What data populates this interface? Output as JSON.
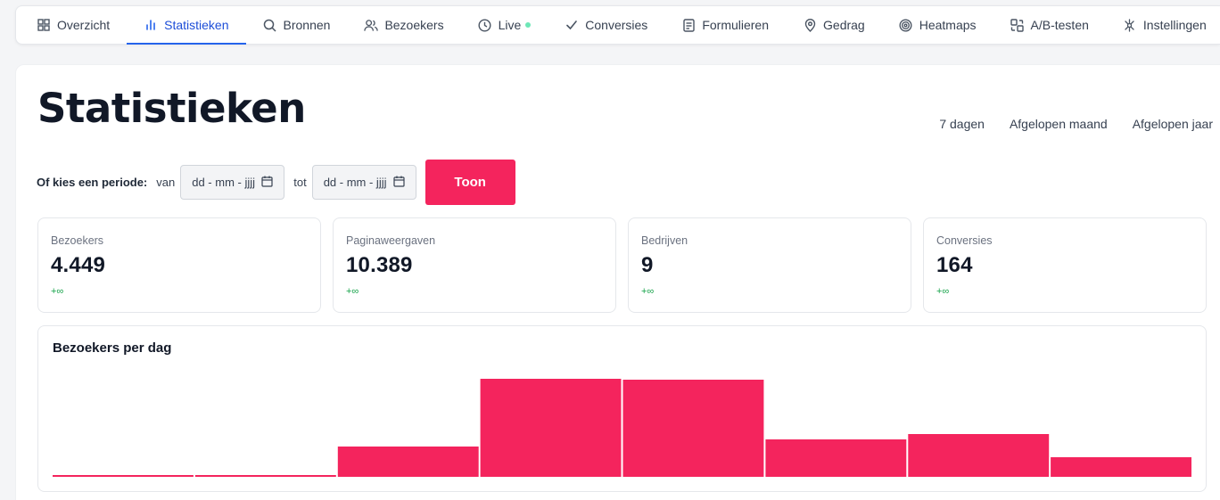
{
  "nav": {
    "tabs": [
      {
        "label": "Overzicht",
        "icon": "grid-icon"
      },
      {
        "label": "Statistieken",
        "icon": "bar-chart-icon",
        "active": true
      },
      {
        "label": "Bronnen",
        "icon": "search-icon"
      },
      {
        "label": "Bezoekers",
        "icon": "users-icon"
      },
      {
        "label": "Live",
        "icon": "clock-icon"
      },
      {
        "label": "Conversies",
        "icon": "check-icon"
      },
      {
        "label": "Formulieren",
        "icon": "form-icon"
      },
      {
        "label": "Gedrag",
        "icon": "map-pin-icon"
      },
      {
        "label": "Heatmaps",
        "icon": "target-icon"
      },
      {
        "label": "A/B-testen",
        "icon": "ab-test-icon"
      },
      {
        "label": "Instellingen",
        "icon": "settings-icon"
      }
    ]
  },
  "page": {
    "title": "Statistieken",
    "quick_ranges": [
      "7 dagen",
      "Afgelopen maand",
      "Afgelopen jaar"
    ]
  },
  "period": {
    "label": "Of kies een periode:",
    "from_word": "van",
    "to_word": "tot",
    "from_placeholder": "dd - mm - jjjj",
    "to_placeholder": "dd - mm - jjjj",
    "submit_label": "Toon"
  },
  "stats": [
    {
      "label": "Bezoekers",
      "value": "4.449",
      "change": "+∞"
    },
    {
      "label": "Paginaweergaven",
      "value": "10.389",
      "change": "+∞"
    },
    {
      "label": "Bedrijven",
      "value": "9",
      "change": "+∞"
    },
    {
      "label": "Conversies",
      "value": "164",
      "change": "+∞"
    }
  ],
  "colors": {
    "accent": "#f4245d",
    "active_tab": "#2563eb",
    "positive": "#16a34a",
    "live_dot": "#6ee7b7"
  },
  "chart_data": {
    "type": "bar",
    "title": "Bezoekers per dag",
    "categories": [],
    "values": [
      2,
      2,
      34,
      110,
      109,
      42,
      48,
      22
    ],
    "ylim": [
      0,
      110
    ],
    "color": "#f4245d"
  }
}
